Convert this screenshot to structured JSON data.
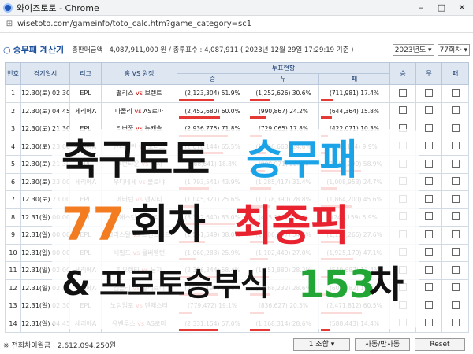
{
  "window": {
    "app_title": "와이즈토토 - Chrome",
    "url": "wisetoto.com/gameinfo/toto_calc.htm?game_category=sc1"
  },
  "header": {
    "title": "승무패 계산기",
    "sales": "총판매금액 : 4,087,911,000 원 / 총투표수 : 4,087,911 ( 2023년 12월 29일 17:29:19 기준 )",
    "year_select": "2023년도",
    "round_select": "77회차"
  },
  "table": {
    "columns": [
      "번호",
      "경기일시",
      "리그",
      "홈 VS 원정",
      "투표현황",
      "승",
      "무",
      "패"
    ],
    "vote_subcolumns": [
      "승",
      "무",
      "패"
    ],
    "vs_label": "vs",
    "rows": [
      {
        "no": "1",
        "date": "12.30(토) 02:30",
        "league": "EPL",
        "home": "팰리스",
        "away": "브렌트",
        "win": "(2,123,304) 51.9%",
        "draw": "(1,252,626) 30.6%",
        "lose": "(711,981) 17.4%",
        "w": 51.9,
        "d": 30.6,
        "l": 17.4
      },
      {
        "no": "2",
        "date": "12.30(토) 04:45",
        "league": "세리에A",
        "home": "나폴리",
        "away": "AS로마",
        "win": "(2,452,680) 60.0%",
        "draw": "(990,867) 24.2%",
        "lose": "(644,364) 15.8%",
        "w": 60.0,
        "d": 24.2,
        "l": 15.8
      },
      {
        "no": "3",
        "date": "12.30(토) 21:30",
        "league": "EPL",
        "home": "리버풀",
        "away": "뉴캐슬",
        "win": "(2,936,775) 71.8%",
        "draw": "(729,065) 17.8%",
        "lose": "(422,071) 10.3%",
        "w": 71.8,
        "d": 17.8,
        "l": 10.3
      },
      {
        "no": "4",
        "date": "12.30(토) 23:00",
        "league": "세리에A",
        "home": "인터밀란",
        "away": "토리노",
        "win": "(2,676,144) 65.5%",
        "draw": "(1,006,663) 24.6%",
        "lose": "(405,104) 9.9%",
        "w": 65.5,
        "d": 24.6,
        "l": 9.9
      },
      {
        "no": "5",
        "date": "12.30(토) 21:30",
        "league": "EPL",
        "home": "루턴타운",
        "away": "첼시",
        "win": "(768,641) 18.8%",
        "draw": "(909,971) 22.3%",
        "lose": "(2,409,299) 58.9%",
        "w": 18.8,
        "d": 22.3,
        "l": 58.9
      },
      {
        "no": "6",
        "date": "12.30(토) 23:00",
        "league": "세리에A",
        "home": "우디네세",
        "away": "볼로냐",
        "win": "(1,793,541) 43.9%",
        "draw": "(1,285,417) 31.4%",
        "lose": "(1,008,953) 24.7%",
        "w": 43.9,
        "d": 31.4,
        "l": 24.7
      },
      {
        "no": "7",
        "date": "12.30(토) 23:00",
        "league": "EPL",
        "home": "에버턴",
        "away": "맨시티",
        "win": "(1,045,321) 25.6%",
        "draw": "(1,178,390) 28.8%",
        "lose": "(1,864,200) 45.6%",
        "w": 25.6,
        "d": 28.8,
        "l": 45.6
      },
      {
        "no": "8",
        "date": "12.31(일) 00:00",
        "league": "EPL",
        "home": "애스턴",
        "away": "번리",
        "win": "(3,392,640) 83.0%",
        "draw": "(455,112) 11.1%",
        "lose": "(240,159) 5.9%",
        "w": 83.0,
        "d": 11.1,
        "l": 5.9
      },
      {
        "no": "9",
        "date": "12.31(일) 00:00",
        "league": "EPL",
        "home": "크리스탈",
        "away": "브렌트포드",
        "win": "(1,551,549) 38.0%",
        "draw": "(1,406,097) 34.4%",
        "lose": "(1,130,265) 27.6%",
        "w": 38.0,
        "d": 34.4,
        "l": 27.6
      },
      {
        "no": "10",
        "date": "12.31(일) 00:00",
        "league": "EPL",
        "home": "셰필드",
        "away": "울버햄턴",
        "win": "(1,060,283) 25.9%",
        "draw": "(1,102,449) 27.0%",
        "lose": "(1,925,179) 47.1%",
        "w": 25.9,
        "d": 27.0,
        "l": 47.1
      },
      {
        "no": "11",
        "date": "12.31(일) 02:00",
        "league": "세리에A",
        "home": "피오렌티",
        "away": "몬차",
        "win": "(2,386,344) 58.4%",
        "draw": "(1,151,880) 28.2%",
        "lose": "(549,687) 13.4%",
        "w": 58.4,
        "d": 28.2,
        "l": 13.4
      },
      {
        "no": "12",
        "date": "12.31(일) 02:30",
        "league": "세리에A",
        "home": "엠폴리",
        "away": "살레르니",
        "win": "(2,315,197) 56.6%",
        "draw": "(1,168,232) 28.6%",
        "lose": "(604,482) 14.8%",
        "w": 56.6,
        "d": 28.6,
        "l": 14.8
      },
      {
        "no": "13",
        "date": "12.31(일) 02:30",
        "league": "EPL",
        "home": "노팅엄포",
        "away": "맨체스터",
        "win": "(779,472) 19.1%",
        "draw": "(836,627) 20.5%",
        "lose": "(2,471,812) 60.5%",
        "w": 19.1,
        "d": 20.5,
        "l": 60.5
      },
      {
        "no": "14",
        "date": "12.31(일) 04:45",
        "league": "세리에A",
        "home": "유벤투스",
        "away": "AS로마",
        "win": "(2,331,154) 57.0%",
        "draw": "(1,168,314) 28.6%",
        "lose": "(588,443) 14.4%",
        "w": 57.0,
        "d": 28.6,
        "l": 14.4
      }
    ]
  },
  "footer": {
    "total": "※ 전회차이월금 : 2,612,094,250원",
    "combo_select": "1 조합",
    "auto_button": "자동/반자동",
    "reset_button": "Reset"
  },
  "overlay": {
    "line1_a": "축구토토",
    "line1_b": "승무패",
    "line2_num": "77",
    "line2_a": "회차",
    "line2_b": "최종픽",
    "line3_amp": "&",
    "line3_a": "프로토승부식",
    "line3_num": "153",
    "line3_b": "차"
  },
  "colors": {
    "orange": "#f47c20",
    "blue": "#1ba3e8",
    "red": "#e8232f",
    "green": "#22a635",
    "black": "#111111",
    "header_blue": "#1a4f9c"
  }
}
